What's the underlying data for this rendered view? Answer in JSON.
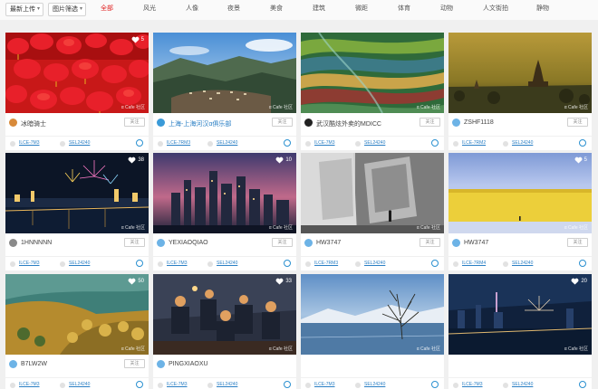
{
  "toolbar": {
    "sort_label": "最新上传",
    "filter_label": "图片筛选",
    "categories": [
      "全部",
      "风光",
      "人像",
      "夜景",
      "美食",
      "建筑",
      "微距",
      "体育",
      "动物",
      "人文街拍",
      "静物"
    ],
    "active_category": "全部"
  },
  "watermark": "α Cafe 社区",
  "follow_label": "关注",
  "cards": [
    {
      "likes": "5",
      "user": "冰暗骑士",
      "camera": "ILCE-7M3",
      "lens": "SEL24240",
      "avatar_color": "#d88a3a",
      "user_is_link": false
    },
    {
      "likes": "",
      "user": "上海-上海河汉α俱乐部",
      "camera": "ILCE-7RM3",
      "lens": "SEL24240",
      "avatar_color": "#3a9ad8",
      "user_is_link": true
    },
    {
      "likes": "",
      "user": "武汉酷炫外卖的MDICC",
      "camera": "ILCE-7M3",
      "lens": "SEL24240",
      "avatar_color": "#222222",
      "user_is_link": false
    },
    {
      "likes": "",
      "user": "ZSHF1118",
      "camera": "ILCE-7RM2",
      "lens": "SEL24240",
      "avatar_color": "#6db3e6",
      "user_is_link": false
    },
    {
      "likes": "38",
      "user": "1HNNNNN",
      "camera": "ILCE-7M3",
      "lens": "SEL24240",
      "avatar_color": "#8a8a8a",
      "user_is_link": false
    },
    {
      "likes": "10",
      "user": "YEXIAOQIAO",
      "camera": "ILCE-7M3",
      "lens": "SEL24240",
      "avatar_color": "#6db3e6",
      "user_is_link": false
    },
    {
      "likes": "",
      "user": "HW3747",
      "camera": "ILCE-7RM3",
      "lens": "SEL24240",
      "avatar_color": "#6db3e6",
      "user_is_link": false
    },
    {
      "likes": "5",
      "user": "HW3747",
      "camera": "ILCE-7RM4",
      "lens": "SEL24240",
      "avatar_color": "#6db3e6",
      "user_is_link": false
    },
    {
      "likes": "50",
      "user": "B7LW2W",
      "camera": "ILCE-7M3",
      "lens": "SEL24240",
      "avatar_color": "#6db3e6",
      "user_is_link": false
    },
    {
      "likes": "33",
      "user": "PINGXIAOXU",
      "camera": "ILCE-7M3",
      "lens": "SEL24240",
      "avatar_color": "#6db3e6",
      "user_is_link": false
    },
    {
      "likes": "",
      "user": "",
      "camera": "ILCE-7M3",
      "lens": "SEL24240",
      "avatar_color": "",
      "user_is_link": false
    },
    {
      "likes": "20",
      "user": "",
      "camera": "ILCE-7M3",
      "lens": "SEL24240",
      "avatar_color": "",
      "user_is_link": false
    }
  ]
}
